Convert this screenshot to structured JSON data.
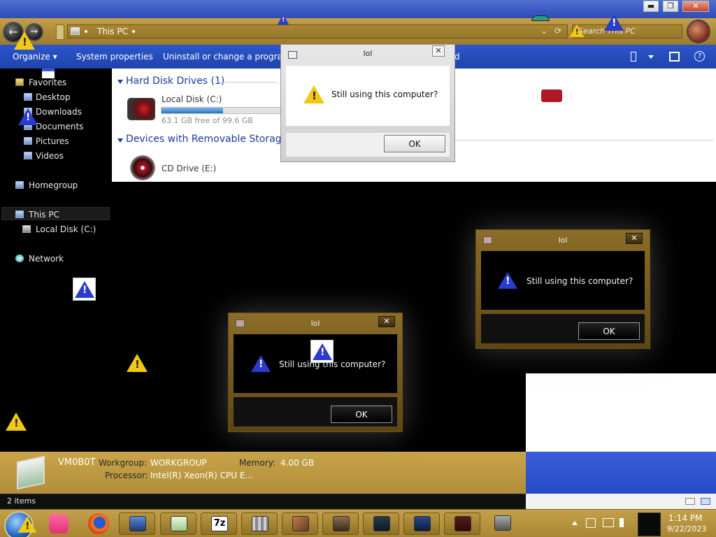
{
  "window": {
    "minimize": "▬",
    "maximize": "❐",
    "close": "✕"
  },
  "address": {
    "path": "This PC",
    "dropdown": "⌄",
    "refresh": "⟳"
  },
  "search": {
    "placeholder": "Search This PC"
  },
  "toolbar": {
    "organize": "Organize ▾",
    "system_properties": "System properties",
    "uninstall": "Uninstall or change a program",
    "cut_off": "d",
    "help": "?"
  },
  "sidebar": {
    "favorites": "Favorites",
    "desktop": "Desktop",
    "downloads": "Downloads",
    "documents": "Documents",
    "pictures": "Pictures",
    "videos": "Videos",
    "homegroup": "Homegroup",
    "this_pc": "This PC",
    "local_disk": "Local Disk (C:)",
    "network": "Network"
  },
  "content": {
    "hdd_group": "Hard Disk Drives (1)",
    "removable_group": "Devices with Removable Storage (1)",
    "local_disk_name": "Local Disk (C:)",
    "local_disk_free": "63.1 GB free of 99.6 GB",
    "local_disk_used_fraction": 0.37,
    "cd_drive_name": "CD Drive (E:)"
  },
  "details": {
    "computer_name": "VM0B0T",
    "workgroup_label": "Workgroup:",
    "workgroup_value": "WORKGROUP",
    "memory_label": "Memory:",
    "memory_value": "4.00 GB",
    "processor_label": "Processor:",
    "processor_value": "Intel(R) Xeon(R) CPU E..."
  },
  "status": {
    "items": "2 items"
  },
  "dialogs": [
    {
      "title": "lol",
      "message": "Still using this computer?",
      "ok": "OK",
      "close": "✕"
    },
    {
      "title": "lol",
      "message": "Still using this computer?",
      "ok": "OK",
      "close": "✕"
    },
    {
      "title": "lol",
      "message": "Still using this computer?",
      "ok": "OK",
      "close": "✕"
    }
  ],
  "taskbar": {
    "apps": [
      "start-orb",
      "chat-app",
      "firefox",
      "file-explorer",
      "notepad",
      "7zip",
      "disk-defrag",
      "book-reader",
      "calculator",
      "task-manager",
      "text-editor",
      "media-player",
      "system-info"
    ],
    "sevenzip_label": "7z",
    "clock_time": "1:14 PM",
    "clock_date": "9/22/2023"
  },
  "colors": {
    "gold": "#b8933e",
    "blue_toolbar": "#2548b8",
    "warning_yellow": "#f2c816",
    "warning_blue": "#2a3ccd"
  }
}
